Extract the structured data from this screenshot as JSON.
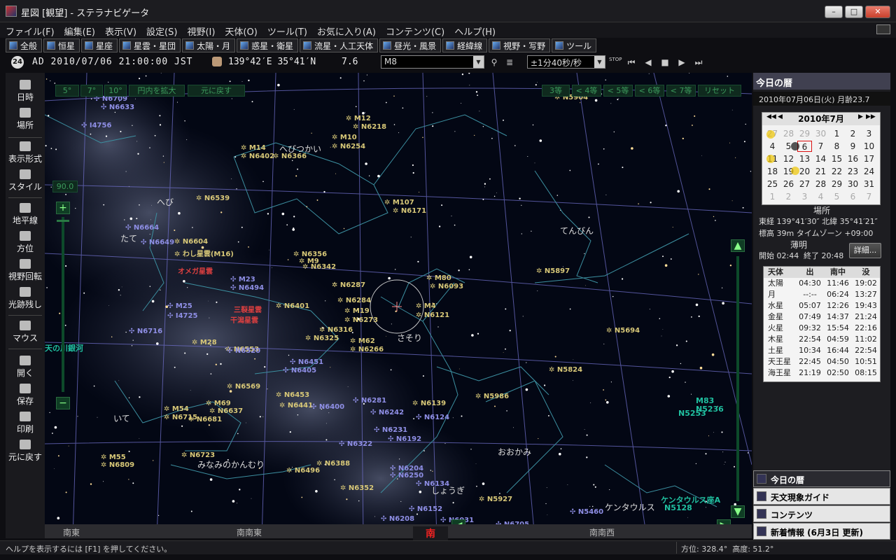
{
  "window": {
    "title": "星図 [観望] - ステラナビゲータ"
  },
  "menu": [
    "ファイル(F)",
    "編集(E)",
    "表示(V)",
    "設定(S)",
    "視野(I)",
    "天体(O)",
    "ツール(T)",
    "お気に入り(A)",
    "コンテンツ(C)",
    "ヘルプ(H)"
  ],
  "tabs": [
    "全般",
    "恒星",
    "星座",
    "星雲・星団",
    "太陽・月",
    "惑星・衛星",
    "流星・人工天体",
    "昼光・風景",
    "経緯線",
    "視野・写野",
    "ツール"
  ],
  "toolbar": {
    "time_badge": "24",
    "datetime": "AD 2010/07/06 21:00:00 JST",
    "coords": "139°42′E 35°41′N",
    "fov": "7.6",
    "object_search": "M8",
    "speed": "±1分40秒/秒",
    "stop_label": "STOP"
  },
  "sidebar": [
    "日時",
    "場所",
    "表示形式",
    "スタイル",
    "地平線",
    "方位",
    "視野回転",
    "光跡残し",
    "マウス",
    "開く",
    "保存",
    "印刷",
    "元に戻す"
  ],
  "sky": {
    "top_left_buttons": [
      "5°",
      "7°",
      "10°",
      "円内を拡大",
      "元に戻す"
    ],
    "top_right_buttons": [
      "3等",
      "< 4等",
      "< 5等",
      "< 6等",
      "< 7等",
      "リセット"
    ],
    "zoom_value": "90.0",
    "directions": [
      "南東",
      "南南東",
      "南",
      "南南西"
    ],
    "constellations": [
      "へびつかい",
      "へび",
      "たて",
      "てんびん",
      "さそり",
      "いて",
      "みなみのかんむり",
      "おおかみ",
      "しょうぎ",
      "ケンタウルス"
    ],
    "milky_way_label": "天の川銀河",
    "objects": [
      {
        "t": "N6709",
        "c": "gal"
      },
      {
        "t": "N6633",
        "c": "gal"
      },
      {
        "t": "I4756",
        "c": "gal"
      },
      {
        "t": "M12",
        "c": "cl"
      },
      {
        "t": "N6218",
        "c": "cl"
      },
      {
        "t": "M10",
        "c": "cl"
      },
      {
        "t": "N6254",
        "c": "cl"
      },
      {
        "t": "M14",
        "c": "cl"
      },
      {
        "t": "N6402",
        "c": "cl"
      },
      {
        "t": "N6366",
        "c": "cl"
      },
      {
        "t": "N6539",
        "c": "cl"
      },
      {
        "t": "M107",
        "c": "cl"
      },
      {
        "t": "N6171",
        "c": "cl"
      },
      {
        "t": "N6664",
        "c": "gal"
      },
      {
        "t": "N6649",
        "c": "gal"
      },
      {
        "t": "N6604",
        "c": "cl"
      },
      {
        "t": "わし星雲(M16)",
        "c": "cl"
      },
      {
        "t": "オメガ星雲",
        "c": "neb"
      },
      {
        "t": "N6356",
        "c": "cl"
      },
      {
        "t": "M9",
        "c": "cl"
      },
      {
        "t": "N6342",
        "c": "cl"
      },
      {
        "t": "N6287",
        "c": "cl"
      },
      {
        "t": "M80",
        "c": "cl"
      },
      {
        "t": "N6093",
        "c": "cl"
      },
      {
        "t": "M4",
        "c": "cl"
      },
      {
        "t": "N6121",
        "c": "cl"
      },
      {
        "t": "M23",
        "c": "gal"
      },
      {
        "t": "N6494",
        "c": "gal"
      },
      {
        "t": "N6401",
        "c": "cl"
      },
      {
        "t": "N6284",
        "c": "cl"
      },
      {
        "t": "M19",
        "c": "cl"
      },
      {
        "t": "N6273",
        "c": "cl"
      },
      {
        "t": "三裂星雲",
        "c": "neb"
      },
      {
        "t": "干潟星雲",
        "c": "neb"
      },
      {
        "t": "M25",
        "c": "gal"
      },
      {
        "t": "I4725",
        "c": "gal"
      },
      {
        "t": "N6316",
        "c": "cl"
      },
      {
        "t": "N6325",
        "c": "cl"
      },
      {
        "t": "M62",
        "c": "cl"
      },
      {
        "t": "N6266",
        "c": "cl"
      },
      {
        "t": "N5897",
        "c": "cl"
      },
      {
        "t": "N6716",
        "c": "gal"
      },
      {
        "t": "M28",
        "c": "cl"
      },
      {
        "t": "N6553",
        "c": "cl"
      },
      {
        "t": "N6520",
        "c": "gal"
      },
      {
        "t": "N6451",
        "c": "gal"
      },
      {
        "t": "N6405",
        "c": "gal"
      },
      {
        "t": "N5694",
        "c": "cl"
      },
      {
        "t": "N5824",
        "c": "cl"
      },
      {
        "t": "N6569",
        "c": "cl"
      },
      {
        "t": "N6453",
        "c": "cl"
      },
      {
        "t": "N6441",
        "c": "cl"
      },
      {
        "t": "N6400",
        "c": "gal"
      },
      {
        "t": "N6281",
        "c": "gal"
      },
      {
        "t": "N6139",
        "c": "cl"
      },
      {
        "t": "N6242",
        "c": "gal"
      },
      {
        "t": "N6124",
        "c": "gal"
      },
      {
        "t": "N5986",
        "c": "cl"
      },
      {
        "t": "M54",
        "c": "cl"
      },
      {
        "t": "N6715",
        "c": "cl"
      },
      {
        "t": "M69",
        "c": "cl"
      },
      {
        "t": "N6637",
        "c": "cl"
      },
      {
        "t": "N6681",
        "c": "cl"
      },
      {
        "t": "N6231",
        "c": "gal"
      },
      {
        "t": "N6192",
        "c": "gal"
      },
      {
        "t": "N6322",
        "c": "gal"
      },
      {
        "t": "M55",
        "c": "cl"
      },
      {
        "t": "N6809",
        "c": "cl"
      },
      {
        "t": "N6723",
        "c": "cl"
      },
      {
        "t": "N6388",
        "c": "cl"
      },
      {
        "t": "N6496",
        "c": "cl"
      },
      {
        "t": "N6352",
        "c": "cl"
      },
      {
        "t": "N6204",
        "c": "gal"
      },
      {
        "t": "N6250",
        "c": "gal"
      },
      {
        "t": "N6134",
        "c": "gal"
      },
      {
        "t": "N6152",
        "c": "gal"
      },
      {
        "t": "N6208",
        "c": "gal"
      },
      {
        "t": "N6031",
        "c": "gal"
      },
      {
        "t": "N5927",
        "c": "cl"
      },
      {
        "t": "N5460",
        "c": "gal"
      },
      {
        "t": "N5128",
        "c": "green"
      },
      {
        "t": "ケンタウルス座A",
        "c": "green"
      },
      {
        "t": "M83",
        "c": "green"
      },
      {
        "t": "N5236",
        "c": "green"
      },
      {
        "t": "N5253",
        "c": "green"
      },
      {
        "t": "N5904",
        "c": "cl"
      },
      {
        "t": "N6705",
        "c": "gal"
      }
    ]
  },
  "right_panel": {
    "header": "今日の暦",
    "date_line": "2010年07月06日(火)  月齢23.7",
    "calendar_title": "2010年7月",
    "calendar": [
      [
        "27",
        "28",
        "29",
        "30",
        "1",
        "2",
        "3"
      ],
      [
        "4",
        "5",
        "6",
        "7",
        "8",
        "9",
        "10"
      ],
      [
        "11",
        "12",
        "13",
        "14",
        "15",
        "16",
        "17"
      ],
      [
        "18",
        "19",
        "20",
        "21",
        "22",
        "23",
        "24"
      ],
      [
        "25",
        "26",
        "27",
        "28",
        "29",
        "30",
        "31"
      ],
      [
        "1",
        "2",
        "3",
        "4",
        "5",
        "6",
        "7"
      ]
    ],
    "place_label": "場所",
    "place_line": "東経 139°41′30″  北緯 35°41′21″",
    "elev_line": "標高 39m    タイムゾーン +09:00",
    "twilight_label": "薄明",
    "twilight_start": "開始 02:44",
    "twilight_end": "終了 20:48",
    "detail_button": "詳細...",
    "table_header": [
      "天体",
      "出",
      "南中",
      "没"
    ],
    "table_rows": [
      [
        "太陽",
        "04:30",
        "11:46",
        "19:02"
      ],
      [
        "月",
        "--:--",
        "06:24",
        "13:27"
      ],
      [
        "水星",
        "05:07",
        "12:26",
        "19:43"
      ],
      [
        "金星",
        "07:49",
        "14:37",
        "21:24"
      ],
      [
        "火星",
        "09:32",
        "15:54",
        "22:16"
      ],
      [
        "木星",
        "22:54",
        "04:59",
        "11:02"
      ],
      [
        "土星",
        "10:34",
        "16:44",
        "22:54"
      ],
      [
        "天王星",
        "22:45",
        "04:50",
        "10:51"
      ],
      [
        "海王星",
        "21:19",
        "02:50",
        "08:15"
      ]
    ],
    "panel_tabs": [
      "今日の暦",
      "天文現象ガイド",
      "コンテンツ",
      "新着情報 (6月3日 更新)"
    ]
  },
  "status": {
    "help": "ヘルプを表示するには [F1] を押してください。",
    "azimuth": "方位: 328.4°",
    "altitude": "高度: 51.2°"
  },
  "colors": {
    "constellation_line": "#3c8fa0",
    "grid": "#6e6ec8",
    "cluster": "#d8c878",
    "galaxy": "#8f8fe6",
    "nebula": "#e04040"
  }
}
